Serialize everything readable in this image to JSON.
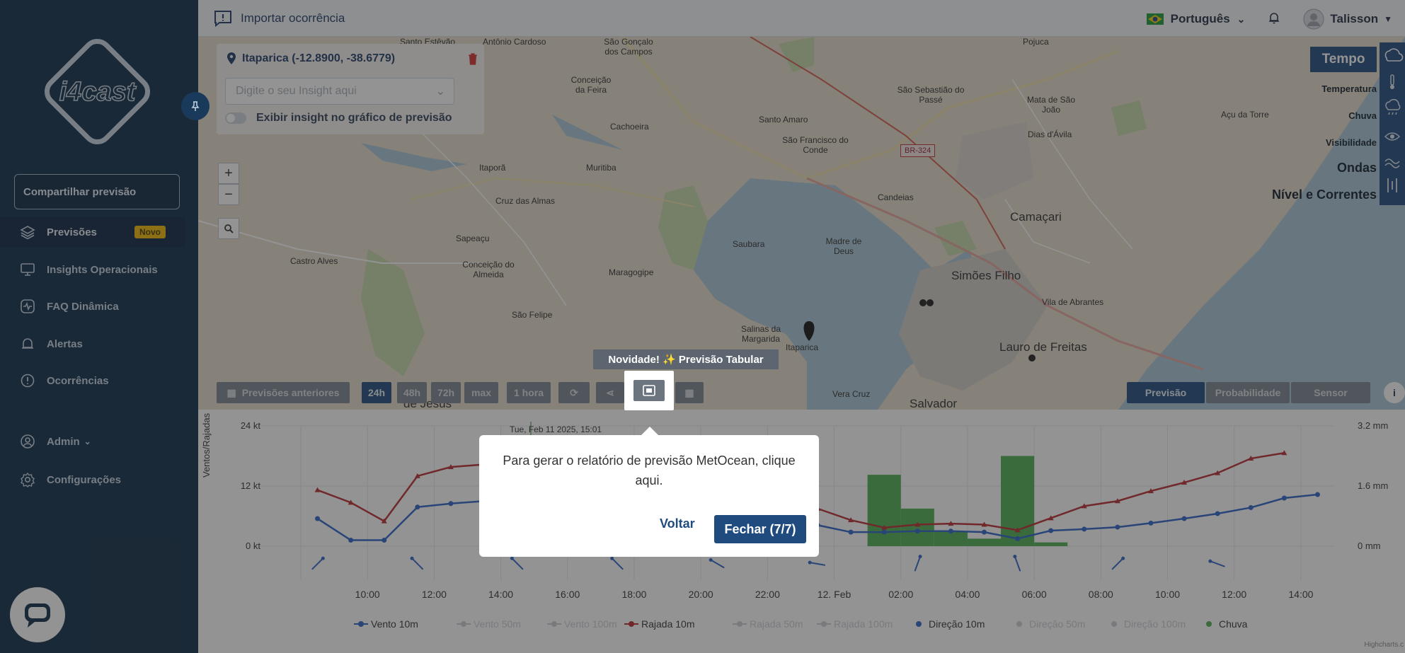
{
  "app": {
    "logo_text": "i4cast"
  },
  "sidebar": {
    "share_label": "Compartilhar previsão",
    "items": [
      {
        "label": "Previsões",
        "icon": "layers-icon",
        "badge": "Novo"
      },
      {
        "label": "Insights Operacionais",
        "icon": "monitor-icon"
      },
      {
        "label": "FAQ Dinâmica",
        "icon": "activity-icon"
      },
      {
        "label": "Alertas",
        "icon": "bell-icon"
      },
      {
        "label": "Ocorrências",
        "icon": "alert-circle-icon"
      },
      {
        "label": "Admin",
        "icon": "user-circle-icon"
      },
      {
        "label": "Configurações",
        "icon": "gear-icon"
      }
    ]
  },
  "topbar": {
    "import_label": "Importar ocorrência",
    "language": "Português",
    "user": "Talisson"
  },
  "map": {
    "location_title": "Itaparica (-12.8900, -38.6779)",
    "insight_placeholder": "Digite o seu Insight aqui",
    "insight_toggle_label": "Exibir insight no gráfico de previsão",
    "labels": [
      "Santo Estêvão",
      "Antônio Cardoso",
      "São Gonçalo dos Campos",
      "Pojuca",
      "Conceição da Feira",
      "São Sebastião do Passé",
      "Mata de São João",
      "Açu da Torre",
      "Santo Amaro",
      "Cachoeira",
      "Muritiba",
      "Itaporã",
      "BR-324",
      "Dias d'Ávila",
      "São Francisco do Conde",
      "Cruz das Almas",
      "Candeias",
      "Camaçari",
      "Sapeaçu",
      "Saubara",
      "Madre de Deus",
      "Castro Alves",
      "Conceição do Almeida",
      "Maragogipe",
      "Simões Filho",
      "Vila de Abrantes",
      "São Felipe",
      "Salinas da Margarida",
      "Itaparica",
      "Lauro de Freitas",
      "Vera Cruz",
      "Salvador",
      "de Jesus"
    ],
    "layers": [
      "Tempo",
      "Temperatura",
      "Chuva",
      "Visibilidade",
      "Ondas",
      "Nível e Correntes"
    ],
    "toolbar": {
      "previous_label": "Previsões anteriores",
      "ranges": [
        "24h",
        "48h",
        "72h",
        "max"
      ],
      "step": "1 hora",
      "modes": [
        "Previsão",
        "Probabilidade",
        "Sensor"
      ]
    }
  },
  "tour": {
    "novidade": "Novidade! ✨ Previsão Tabular",
    "message": "Para gerar o relatório de previsão MetOcean, clique aqui.",
    "back_label": "Voltar",
    "close_label": "Fechar (7/7)"
  },
  "chart_data": {
    "type": "line",
    "ylabel": "Ventos/Rajadas",
    "y_ticks": [
      "24 kt",
      "12 kt",
      "0 kt"
    ],
    "y2_ticks": [
      "3.2 mm",
      "1.6 mm",
      "0 mm"
    ],
    "tooltip_date": "Tue, Feb 11 2025, 15:01",
    "x_ticks": [
      "10:00",
      "12:00",
      "14:00",
      "16:00",
      "18:00",
      "20:00",
      "22:00",
      "12. Feb",
      "02:00",
      "04:00",
      "06:00",
      "08:00",
      "10:00",
      "12:00",
      "14:00"
    ],
    "credits": "Highcharts.c",
    "ylim": [
      0,
      24
    ],
    "y2lim": [
      0,
      3.2
    ],
    "series": [
      {
        "name": "Vento 10m",
        "color": "#2b62c8",
        "points": [
          [
            0,
            5.5
          ],
          [
            1,
            1.2
          ],
          [
            2,
            1.2
          ],
          [
            3,
            7.8
          ],
          [
            4,
            8.5
          ],
          [
            5,
            9.0
          ],
          [
            15,
            4.2
          ],
          [
            16,
            2.8
          ],
          [
            17,
            2.8
          ],
          [
            18,
            3.0
          ],
          [
            19,
            3.0
          ],
          [
            20,
            2.8
          ],
          [
            21,
            1.5
          ],
          [
            22,
            3.1
          ],
          [
            23,
            3.4
          ],
          [
            24,
            3.8
          ],
          [
            25,
            4.6
          ],
          [
            26,
            5.5
          ],
          [
            27,
            6.5
          ],
          [
            28,
            7.7
          ],
          [
            29,
            9.6
          ],
          [
            30,
            10.3
          ]
        ]
      },
      {
        "name": "Rajada 10m",
        "color": "#b8282e",
        "points": [
          [
            0,
            11.2
          ],
          [
            1,
            8.7
          ],
          [
            2,
            5.0
          ],
          [
            3,
            14.0
          ],
          [
            4,
            15.8
          ],
          [
            5,
            16.3
          ],
          [
            15,
            7.5
          ],
          [
            16,
            5.2
          ],
          [
            17,
            3.7
          ],
          [
            18,
            4.3
          ],
          [
            19,
            4.5
          ],
          [
            20,
            4.3
          ],
          [
            21,
            3.2
          ],
          [
            22,
            5.6
          ],
          [
            23,
            8.0
          ],
          [
            24,
            9.0
          ],
          [
            25,
            11.0
          ],
          [
            26,
            12.7
          ],
          [
            27,
            14.6
          ],
          [
            28,
            17.5
          ],
          [
            29,
            18.6
          ]
        ]
      },
      {
        "name": "Chuva",
        "color": "#4caf50",
        "bars": [
          [
            17,
            1.9
          ],
          [
            18,
            1.0
          ],
          [
            19,
            0.4
          ],
          [
            20,
            0.2
          ],
          [
            21,
            2.4
          ],
          [
            22,
            0.1
          ]
        ]
      }
    ],
    "legend": [
      "Vento 10m",
      "Vento 50m",
      "Vento 100m",
      "Rajada 10m",
      "Rajada 50m",
      "Rajada 100m",
      "Direção 10m",
      "Direção 50m",
      "Direção 100m",
      "Chuva"
    ]
  }
}
